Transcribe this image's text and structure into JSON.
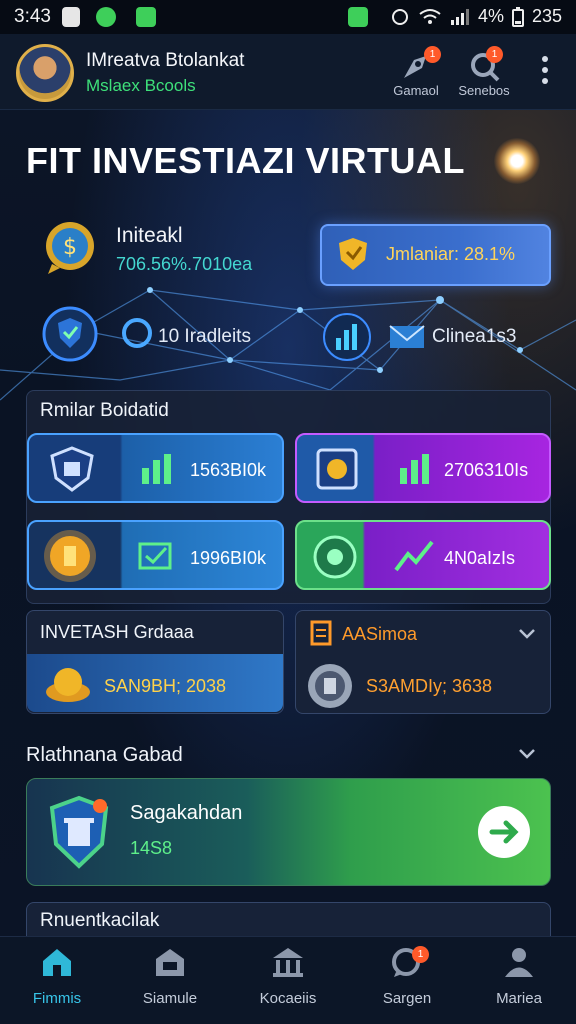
{
  "status_bar": {
    "time": "3:43",
    "battery": "4%",
    "clock_right": "235"
  },
  "header": {
    "title": "IMreatva Btolankat",
    "subtitle": "Mslaex Bcools",
    "actions": [
      {
        "label": "Gamaol",
        "icon": "rocket-icon",
        "badge": "1"
      },
      {
        "label": "Senebos",
        "icon": "search-icon",
        "badge": "1"
      }
    ]
  },
  "hero": {
    "title": "FIT INVESTIAZI VIRTUAL",
    "total_label": "Initeakl",
    "total_value": "706.56%.7010ea",
    "highlight_label": "Jmlaniar: 28.1%",
    "row_left_label": "10 Iradleits",
    "row_right_label": "Clinea1s3"
  },
  "panel": {
    "title": "Rmilar Boidatid",
    "tiles": [
      {
        "value": "1563BI0k",
        "icon": "chart-icon"
      },
      {
        "value": "2706310Is",
        "icon": "chart-icon"
      },
      {
        "value": "1996BI0k",
        "icon": "check-icon"
      },
      {
        "value": "4N0aIzIs",
        "icon": "chart-icon"
      }
    ]
  },
  "cards": {
    "left_title": "INVETASH Grdaaa",
    "left_value": "SAN9BH; 2038",
    "right_title": "AASimoa",
    "right_value": "S3AMDIy; 3638"
  },
  "section2": {
    "title": "Rlathnana Gabad"
  },
  "promo": {
    "title": "Sagakahdan",
    "value": "14S8"
  },
  "section3": {
    "title": "Rnuentkacilak"
  },
  "bottom_nav": [
    {
      "label": "Fimmis",
      "icon": "home-icon",
      "active": true
    },
    {
      "label": "Siamule",
      "icon": "store-icon",
      "active": false
    },
    {
      "label": "Kocaeiis",
      "icon": "bank-icon",
      "active": false
    },
    {
      "label": "Sargen",
      "icon": "chat-icon",
      "active": false,
      "badge": "1"
    },
    {
      "label": "Mariea",
      "icon": "profile-icon",
      "active": false
    }
  ]
}
